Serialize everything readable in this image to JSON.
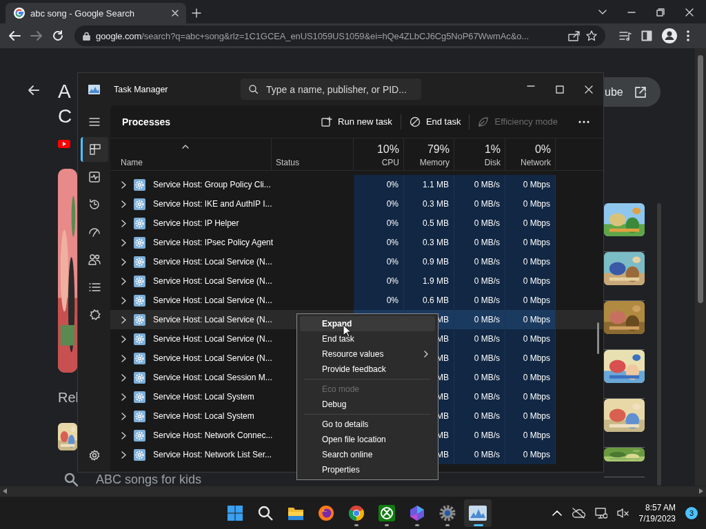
{
  "browser": {
    "tab": {
      "title": "abc song - Google Search"
    },
    "url": {
      "host": "google.com",
      "path": "/search?q=abc+song&rlz=1C1GCEA_enUS1059US1059&ei=hQe4ZLbCJ6Cg5NoP67WwmAc&o..."
    }
  },
  "page": {
    "title_lines": [
      "A",
      "C"
    ],
    "button": "ube",
    "section": "Rel",
    "search_suggestion": "ABC songs for kids"
  },
  "task_manager": {
    "title": "Task Manager",
    "search": {
      "placeholder": "Type a name, publisher, or PID..."
    },
    "nav": [
      {
        "selected": true
      },
      {
        "selected": false
      },
      {
        "selected": false
      },
      {
        "selected": false
      },
      {
        "selected": false
      },
      {
        "selected": false
      },
      {
        "selected": false
      }
    ],
    "page_title": "Processes",
    "actions": [
      {
        "label": "Run new task",
        "disabled": false
      },
      {
        "label": "End task",
        "disabled": false
      },
      {
        "label": "Efficiency mode",
        "disabled": true
      }
    ],
    "columns": [
      {
        "label": "Name"
      },
      {
        "label": "Status"
      },
      {
        "usage": "10%",
        "label": "CPU"
      },
      {
        "usage": "79%",
        "label": "Memory"
      },
      {
        "usage": "1%",
        "label": "Disk"
      },
      {
        "usage": "0%",
        "label": "Network"
      }
    ],
    "rows": [
      {
        "name": "Service Host: Group Policy Cli...",
        "cpu": "0%",
        "memory": "1.1 MB",
        "disk": "0 MB/s",
        "network": "0 Mbps",
        "selected": false
      },
      {
        "name": "Service Host: IKE and AuthIP I...",
        "cpu": "0%",
        "memory": "0.3 MB",
        "disk": "0 MB/s",
        "network": "0 Mbps",
        "selected": false
      },
      {
        "name": "Service Host: IP Helper",
        "cpu": "0%",
        "memory": "0.5 MB",
        "disk": "0 MB/s",
        "network": "0 Mbps",
        "selected": false
      },
      {
        "name": "Service Host: IPsec Policy Agent",
        "cpu": "0%",
        "memory": "0.3 MB",
        "disk": "0 MB/s",
        "network": "0 Mbps",
        "selected": false
      },
      {
        "name": "Service Host: Local Service (N...",
        "cpu": "0%",
        "memory": "0.9 MB",
        "disk": "0 MB/s",
        "network": "0 Mbps",
        "selected": false
      },
      {
        "name": "Service Host: Local Service (N...",
        "cpu": "0%",
        "memory": "1.9 MB",
        "disk": "0 MB/s",
        "network": "0 Mbps",
        "selected": false
      },
      {
        "name": "Service Host: Local Service (N...",
        "cpu": "0%",
        "memory": "0.6 MB",
        "disk": "0 MB/s",
        "network": "0 Mbps",
        "selected": false
      },
      {
        "name": "Service Host: Local Service (N...",
        "memory": "MB",
        "disk": "0 MB/s",
        "network": "0 Mbps",
        "selected": true
      },
      {
        "name": "Service Host: Local Service (N...",
        "memory": "MB",
        "disk": "0 MB/s",
        "network": "0 Mbps",
        "selected": false
      },
      {
        "name": "Service Host: Local Service (N...",
        "memory": "MB",
        "disk": "0 MB/s",
        "network": "0 Mbps",
        "selected": false
      },
      {
        "name": "Service Host: Local Session M...",
        "memory": "MB",
        "disk": "0 MB/s",
        "network": "0 Mbps",
        "selected": false
      },
      {
        "name": "Service Host: Local System",
        "memory": "MB",
        "disk": "0 MB/s",
        "network": "0 Mbps",
        "selected": false
      },
      {
        "name": "Service Host: Local System",
        "memory": "MB",
        "disk": "0 MB/s",
        "network": "0 Mbps",
        "selected": false
      },
      {
        "name": "Service Host: Network Connec...",
        "memory": "MB",
        "disk": "0 MB/s",
        "network": "0 Mbps",
        "selected": false
      },
      {
        "name": "Service Host: Network List Ser...",
        "memory": "MB",
        "disk": "0 MB/s",
        "network": "0 Mbps",
        "selected": false
      }
    ]
  },
  "context_menu": {
    "items": [
      {
        "kind": "item",
        "label": "Expand",
        "default": true,
        "selected": true,
        "disabled": false,
        "submenu": false
      },
      {
        "kind": "item",
        "label": "End task",
        "default": false,
        "selected": false,
        "disabled": false,
        "submenu": false
      },
      {
        "kind": "item",
        "label": "Resource values",
        "default": false,
        "selected": false,
        "disabled": false,
        "submenu": true
      },
      {
        "kind": "item",
        "label": "Provide feedback",
        "default": false,
        "selected": false,
        "disabled": false,
        "submenu": false
      },
      {
        "kind": "separator"
      },
      {
        "kind": "item",
        "label": "Eco mode",
        "default": false,
        "selected": false,
        "disabled": true,
        "submenu": false
      },
      {
        "kind": "item",
        "label": "Debug",
        "default": false,
        "selected": false,
        "disabled": false,
        "submenu": false
      },
      {
        "kind": "separator"
      },
      {
        "kind": "item",
        "label": "Go to details",
        "default": false,
        "selected": false,
        "disabled": false,
        "submenu": false
      },
      {
        "kind": "item",
        "label": "Open file location",
        "default": false,
        "selected": false,
        "disabled": false,
        "submenu": false
      },
      {
        "kind": "item",
        "label": "Search online",
        "default": false,
        "selected": false,
        "disabled": false,
        "submenu": false
      },
      {
        "kind": "item",
        "label": "Properties",
        "default": false,
        "selected": false,
        "disabled": false,
        "submenu": false
      }
    ]
  },
  "taskbar": {
    "apps": [
      {
        "running": false,
        "active": false
      },
      {
        "running": false,
        "active": false
      },
      {
        "running": false,
        "active": false
      },
      {
        "running": false,
        "active": false
      },
      {
        "running": true,
        "active": false
      },
      {
        "running": true,
        "active": false
      },
      {
        "running": true,
        "active": false
      },
      {
        "running": true,
        "active": false
      },
      {
        "running": true,
        "active": true
      }
    ],
    "time": "8:57 AM",
    "date": "7/19/2023",
    "notifications": "3"
  }
}
